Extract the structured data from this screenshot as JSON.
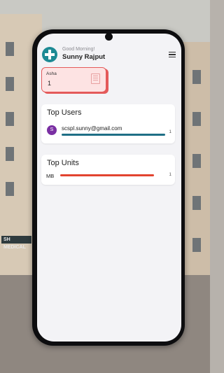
{
  "header": {
    "greeting": "Good Morning!",
    "user_name": "Sunny Rajput"
  },
  "stat_card": {
    "label": "Asha",
    "value": "1"
  },
  "top_users": {
    "title": "Top Users",
    "items": [
      {
        "avatar_letter": "S",
        "email": "scspl.sunny@gmail.com",
        "count": "1",
        "fill": 1.0,
        "bar_color": "#1f6f86"
      }
    ]
  },
  "top_units": {
    "title": "Top Units",
    "items": [
      {
        "name": "MB",
        "count": "1",
        "fill": 1.0,
        "bar_color": "#e2432f"
      }
    ]
  },
  "background": {
    "sign_text": "SH MEDICAL"
  },
  "colors": {
    "brand": "#1d8a94",
    "alert": "#e45a5a",
    "avatar": "#7a2fa3"
  }
}
